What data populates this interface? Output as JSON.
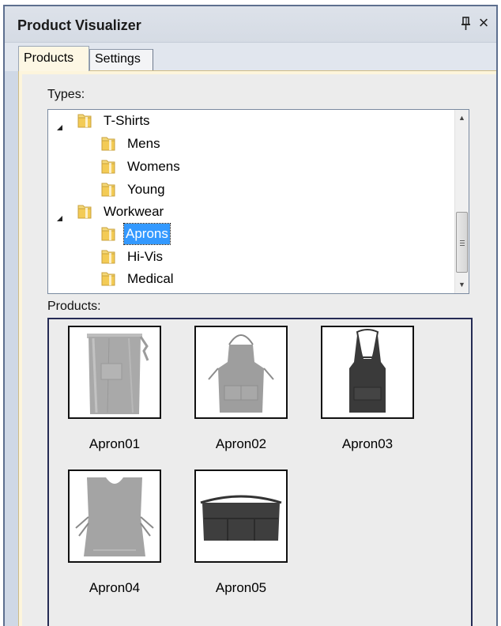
{
  "panel": {
    "title": "Product Visualizer",
    "pin_icon": "pin-icon",
    "close_icon": "close-icon",
    "close_glyph": "×"
  },
  "tabs": [
    {
      "label": "Products",
      "selected": true
    },
    {
      "label": "Settings",
      "selected": false
    }
  ],
  "types": {
    "label": "Types:",
    "tree": [
      {
        "label": "T-Shirts",
        "expanded": true,
        "children": [
          {
            "label": "Mens"
          },
          {
            "label": "Womens"
          },
          {
            "label": "Young"
          }
        ]
      },
      {
        "label": "Workwear",
        "expanded": true,
        "children": [
          {
            "label": "Aprons",
            "selected": true
          },
          {
            "label": "Hi-Vis"
          },
          {
            "label": "Medical"
          }
        ]
      }
    ]
  },
  "products": {
    "label": "Products:",
    "items": [
      {
        "name": "Apron01",
        "icon": "waist-apron-image"
      },
      {
        "name": "Apron02",
        "icon": "bib-apron-image"
      },
      {
        "name": "Apron03",
        "icon": "halter-apron-image"
      },
      {
        "name": "Apron04",
        "icon": "tabard-apron-image"
      },
      {
        "name": "Apron05",
        "icon": "short-waist-apron-image"
      }
    ]
  },
  "colors": {
    "selection": "#3399ff",
    "tab_active": "#fdf7e4",
    "panel_border": "#5d6f8f"
  }
}
